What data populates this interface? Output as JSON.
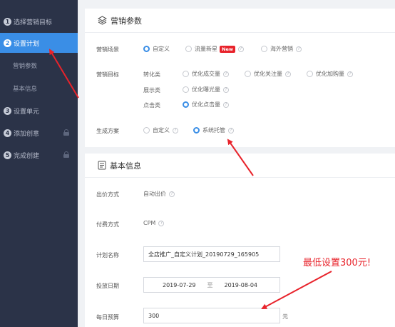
{
  "sidebar": {
    "steps": [
      {
        "num": "1",
        "label": "选择营销目标"
      },
      {
        "num": "2",
        "label": "设置计划"
      },
      {
        "label": "营销参数"
      },
      {
        "label": "基本信息"
      },
      {
        "num": "3",
        "label": "设置单元"
      },
      {
        "num": "4",
        "label": "添加创意"
      },
      {
        "num": "5",
        "label": "完成创建"
      }
    ]
  },
  "marketing": {
    "title": "营销参数",
    "scene_label": "营销场景",
    "scene_options": [
      "自定义",
      "流量新星",
      "海外营销"
    ],
    "new_badge": "New",
    "goal_label": "营销目标",
    "goal_groups": [
      {
        "category": "转化类",
        "options": [
          "优化成交量",
          "优化关注量",
          "优化加购量"
        ]
      },
      {
        "category": "展示类",
        "options": [
          "优化曝光量"
        ]
      },
      {
        "category": "点击类",
        "options": [
          "优化点击量"
        ]
      }
    ],
    "plan_label": "生成方案",
    "plan_options": [
      "自定义",
      "系统托管"
    ]
  },
  "basic": {
    "title": "基本信息",
    "bid_label": "出价方式",
    "bid_value": "自动出价",
    "pay_label": "付费方式",
    "pay_value": "CPM",
    "name_label": "计划名称",
    "name_value": "全店推广_自定义计划_20190729_165905",
    "date_label": "投放日期",
    "date_start": "2019-07-29",
    "date_sep": "至",
    "date_end": "2019-08-04",
    "budget_label": "每日预算",
    "budget_value": "300",
    "budget_unit": "元"
  },
  "annotation": {
    "note": "最低设置300元!",
    "color": "#e8232b"
  },
  "colors": {
    "sidebar_bg": "#2b3348",
    "accent": "#3a8ee6"
  }
}
